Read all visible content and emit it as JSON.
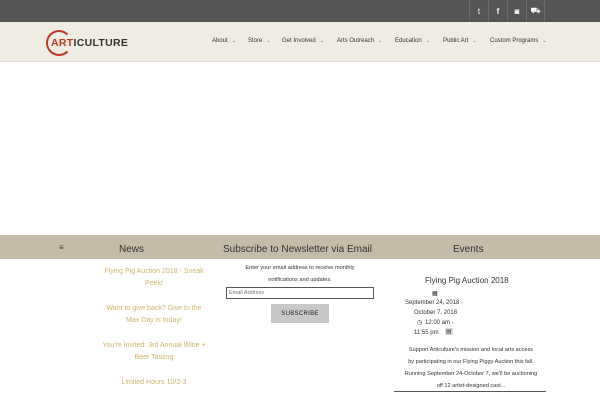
{
  "topbar": {
    "social": [
      {
        "name": "twitter-icon",
        "glyph": "t"
      },
      {
        "name": "facebook-icon",
        "glyph": "f"
      },
      {
        "name": "instagram-icon",
        "glyph": "◙"
      },
      {
        "name": "cart-icon",
        "glyph": "⛟"
      }
    ]
  },
  "logo": {
    "art": "ART",
    "rest": "ICULTURE"
  },
  "nav": [
    {
      "label": "About"
    },
    {
      "label": "Store"
    },
    {
      "label": "Get Involved"
    },
    {
      "label": "Arts Outreach"
    },
    {
      "label": "Education"
    },
    {
      "label": "Public Art"
    },
    {
      "label": "Custom Programs"
    }
  ],
  "band": {
    "menu_glyph": "≡",
    "news_title": "News",
    "newsletter_title": "Subscribe to Newsletter via Email",
    "events_title": "Events"
  },
  "news": {
    "items": [
      {
        "line1": "Flying Pig Auction 2018 - Sneak",
        "line2": "Peek!"
      },
      {
        "line1": "Want to give back? Give to the",
        "line2": "Max Day is today!"
      },
      {
        "line1": "You're Invited: 3rd Annual Wine +",
        "line2": "Beer Tasting"
      },
      {
        "line1": "Limited Hours 10/2-3",
        "line2": ""
      }
    ]
  },
  "newsletter": {
    "desc1": "Enter your email address to receive monthly",
    "desc2": "notifications and updates.",
    "email_placeholder": "Email Address",
    "button": "SUBSCRIBE"
  },
  "events": {
    "title": "Flying Pig Auction 2018",
    "date1": "September 24, 2018 -",
    "date2": "October 7, 2018",
    "time1": "12:00 am -",
    "time2": "11:55 pm",
    "desc1": "Support Articulture's mission and local arts access",
    "desc2": "by participating in our Flying Piggy Auction this fall.",
    "desc3": "Running September 24-October 7, we'll be auctioning",
    "desc4": "off 12 artist-designed cast..."
  },
  "colors": {
    "topbar": "#555555",
    "header": "#efece4",
    "band": "#c4bca8",
    "accent": "#b83a22",
    "link": "#ccb56a"
  }
}
